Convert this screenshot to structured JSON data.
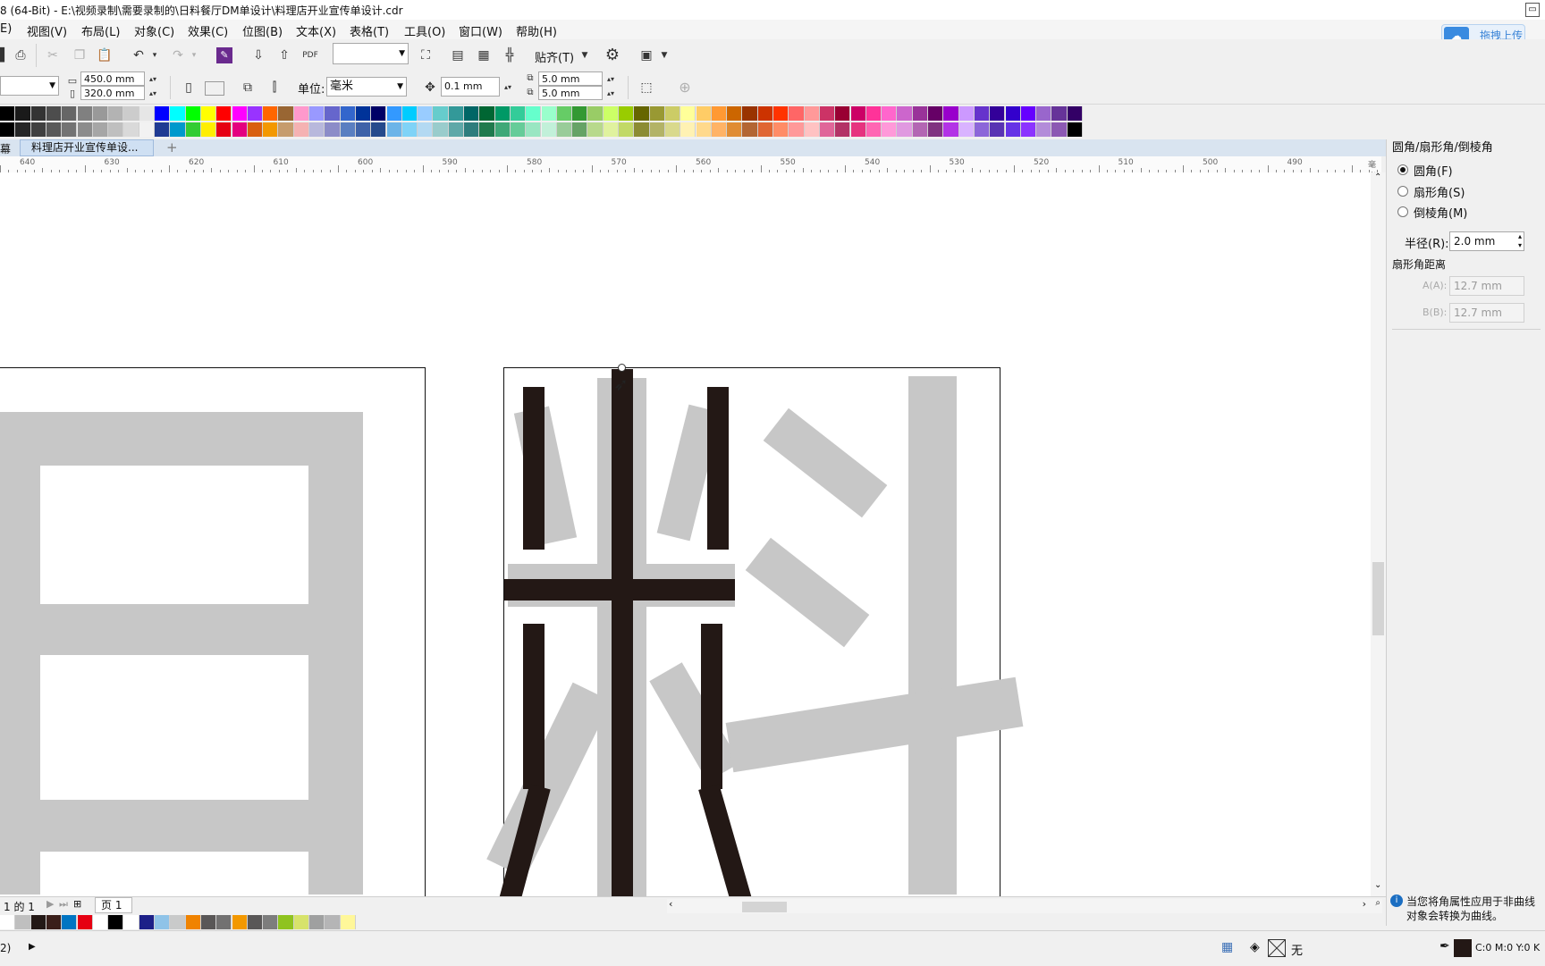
{
  "window": {
    "title": "8 (64-Bit) - E:\\视频录制\\需要录制的\\日料餐厅DM单设计\\料理店开业宣传单设计.cdr"
  },
  "menu": [
    "E)",
    "视图(V)",
    "布局(L)",
    "对象(C)",
    "效果(C)",
    "位图(B)",
    "文本(X)",
    "表格(T)",
    "工具(O)",
    "窗口(W)",
    "帮助(H)"
  ],
  "upload_button": "拖拽上传",
  "toolbar": {
    "snap_label": "贴齐(T)",
    "zoom_value": ""
  },
  "property_bar": {
    "width": "450.0 mm",
    "height": "320.0 mm",
    "unit_label": "单位:",
    "unit_value": "毫米",
    "nudge": "0.1 mm",
    "dup_x": "5.0 mm",
    "dup_y": "5.0 mm"
  },
  "document_tab": "料理店开业宣传单设...",
  "tab_stub": "幕",
  "ruler": {
    "labels": [
      "640",
      "630",
      "620",
      "610",
      "600",
      "590",
      "580",
      "570",
      "560",
      "550",
      "540",
      "530",
      "520",
      "510",
      "500",
      "490",
      "毫米"
    ]
  },
  "docker": {
    "title": "圆角/扇形角/倒棱角",
    "options": [
      {
        "label": "圆角(F)",
        "selected": true
      },
      {
        "label": "扇形角(S)",
        "selected": false
      },
      {
        "label": "倒棱角(M)",
        "selected": false
      }
    ],
    "radius_label": "半径(R):",
    "radius_value": "2.0 mm",
    "section_label": "扇形角距离",
    "a_label": "A(A):",
    "a_value": "12.7 mm",
    "b_label": "B(B):",
    "b_value": "12.7 mm",
    "info_line1": "当您将角属性应用于非曲线",
    "info_line2": "对象会转换为曲线。"
  },
  "page_nav": {
    "counter": "1 的 1",
    "page_tab": "页 1"
  },
  "status": {
    "left": "2)",
    "fill_none": "无",
    "color_info": "C:0 M:0 Y:0 K"
  },
  "palette_colors": {
    "row1": [
      "#000000",
      "#1a1a1a",
      "#333333",
      "#4d4d4d",
      "#666666",
      "#808080",
      "#999999",
      "#b3b3b3",
      "#cccccc",
      "#e6e6e6",
      "#0000ff",
      "#00ffff",
      "#00ff00",
      "#ffff00",
      "#ff0000",
      "#ff00ff",
      "#9933ff",
      "#ff6600",
      "#996633",
      "#ff99cc",
      "#9999ff",
      "#6666cc",
      "#3366cc",
      "#003399",
      "#000066",
      "#3399ff",
      "#00ccff",
      "#99ccff",
      "#66cccc",
      "#339999",
      "#006666",
      "#006633",
      "#009966",
      "#33cc99",
      "#66ffcc",
      "#99ffcc",
      "#66cc66",
      "#339933",
      "#99cc66",
      "#ccff66",
      "#99cc00",
      "#666600",
      "#999933",
      "#cccc66",
      "#ffff99",
      "#ffcc66",
      "#ff9933",
      "#cc6600",
      "#993300",
      "#cc3300",
      "#ff3300",
      "#ff6666",
      "#ff9999",
      "#cc3366",
      "#990033",
      "#cc0066",
      "#ff3399",
      "#ff66cc",
      "#cc66cc",
      "#993399",
      "#660066",
      "#9900cc",
      "#cc99ff",
      "#6633cc",
      "#330099",
      "#3300cc",
      "#6600ff",
      "#9966cc",
      "#663399",
      "#330066"
    ],
    "row2": [
      "#000000",
      "#262626",
      "#404040",
      "#595959",
      "#737373",
      "#8c8c8c",
      "#a6a6a6",
      "#bfbfbf",
      "#d9d9d9",
      "#f2f2f2",
      "#1f3a93",
      "#0099cc",
      "#33cc33",
      "#ffee00",
      "#e60012",
      "#e4007f",
      "#d95f0e",
      "#f39800",
      "#c69c6d",
      "#f5b2b2",
      "#b8b8dc",
      "#8c8cc8",
      "#5a7fc1",
      "#3e62a8",
      "#264a8c",
      "#6cb4e8",
      "#7fd3f7",
      "#b3d9f2",
      "#99cccc",
      "#5fa8a8",
      "#2e7d7d",
      "#1f7a4d",
      "#3fa878",
      "#66cc99",
      "#99e6c2",
      "#c2f0d9",
      "#99cc99",
      "#66a366",
      "#b8d98c",
      "#e0f29e",
      "#c2d966",
      "#8c8c33",
      "#b3b366",
      "#d9d98c",
      "#fff2b3",
      "#ffd98c",
      "#ffb366",
      "#e08c33",
      "#b36633",
      "#e06633",
      "#ff8c66",
      "#ff9999",
      "#ffc2c2",
      "#e06699",
      "#b33366",
      "#e6337f",
      "#ff66b3",
      "#ff99d9",
      "#e099e0",
      "#b366b3",
      "#803380",
      "#b333e6",
      "#d9b3ff",
      "#8c66d9",
      "#5933b3",
      "#6633e6",
      "#8c33ff",
      "#b38cd9",
      "#8c59b3",
      "#000000"
    ]
  }
}
